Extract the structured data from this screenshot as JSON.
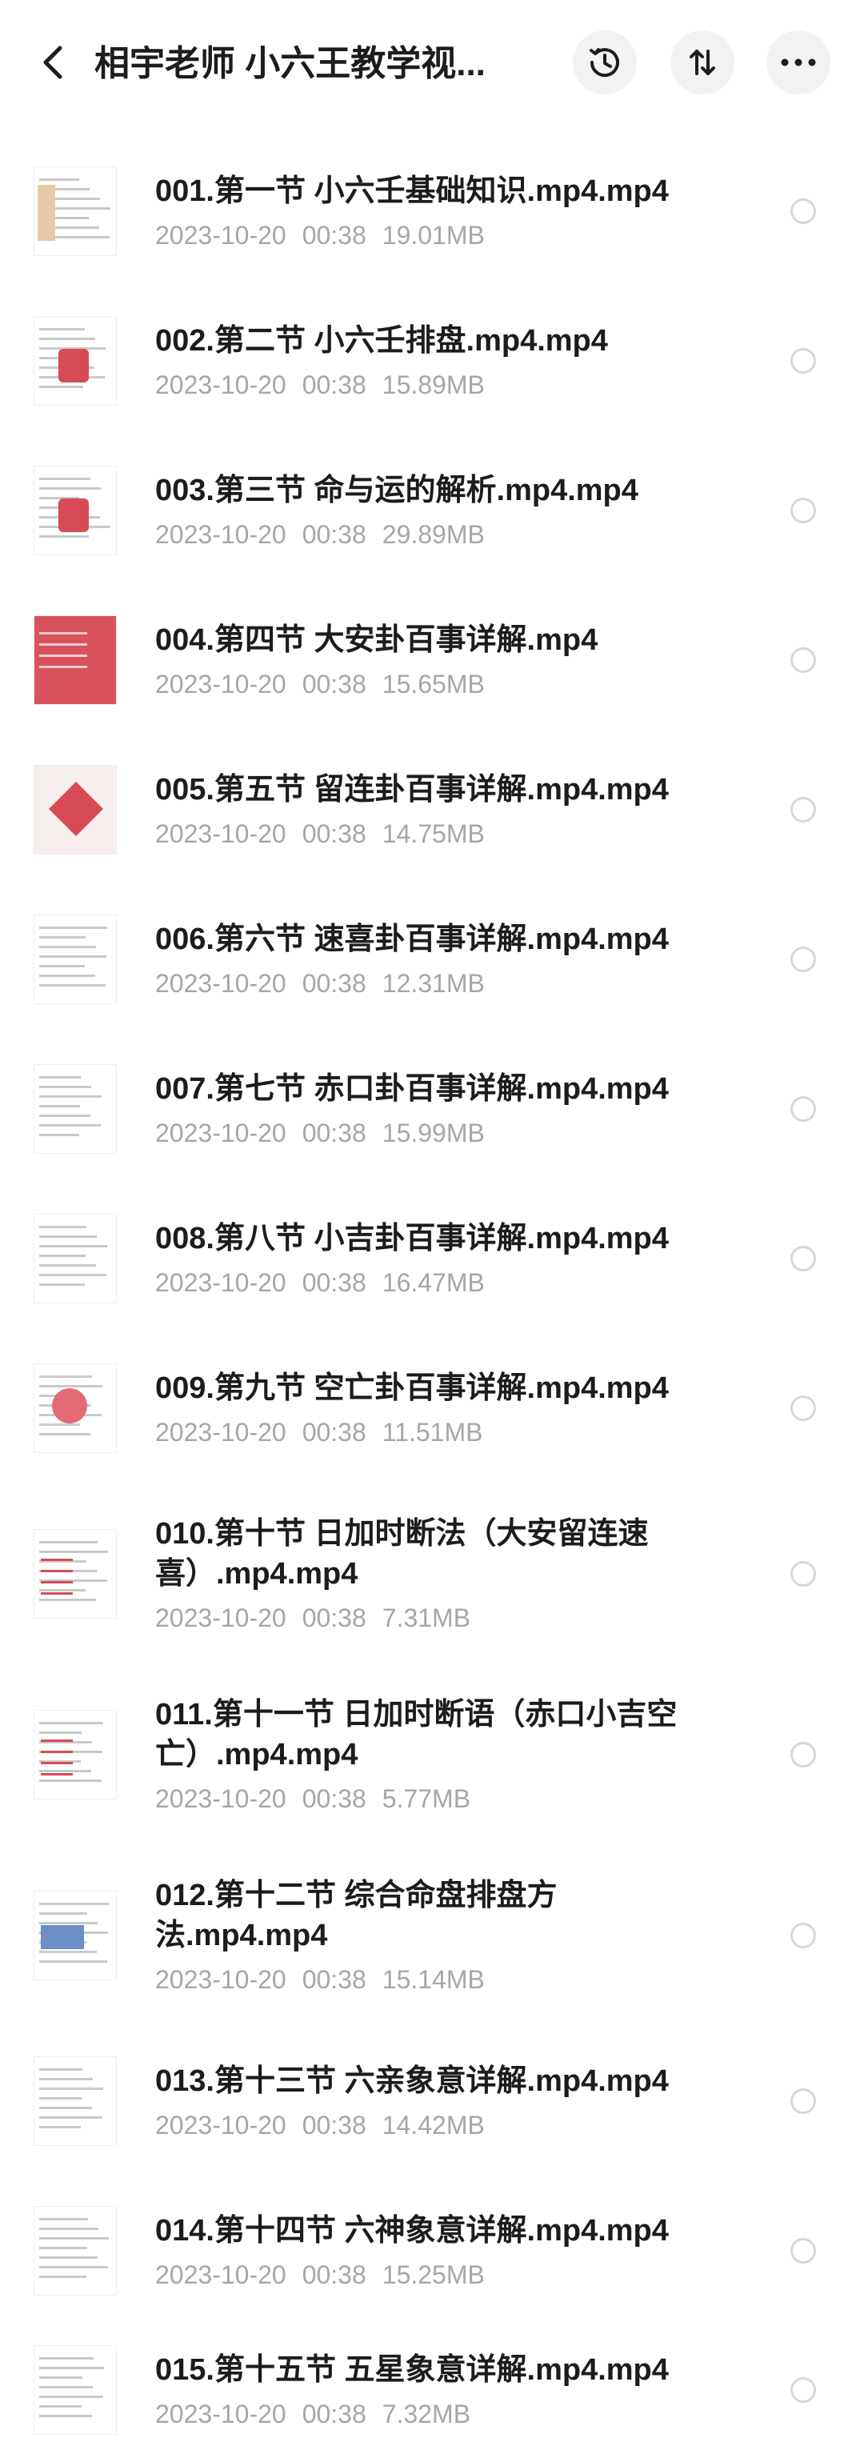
{
  "header": {
    "title": "相宇老师 小六王教学视...",
    "back_icon": "back-arrow-icon",
    "history_icon": "history-clock-icon",
    "sort_icon": "sort-arrows-icon",
    "more_icon": "more-dots-icon"
  },
  "colors": {
    "meta_text": "#a6a6a6",
    "button_bg": "#f1f2f4",
    "thumb_accent": "#d64b55"
  },
  "files": [
    {
      "name": "001.第一节 小六壬基础知识.mp4.mp4",
      "date": "2023-10-20",
      "time": "00:38",
      "size": "19.01MB"
    },
    {
      "name": "002.第二节 小六壬排盘.mp4.mp4",
      "date": "2023-10-20",
      "time": "00:38",
      "size": "15.89MB"
    },
    {
      "name": "003.第三节 命与运的解析.mp4.mp4",
      "date": "2023-10-20",
      "time": "00:38",
      "size": "29.89MB"
    },
    {
      "name": "004.第四节 大安卦百事详解.mp4",
      "date": "2023-10-20",
      "time": "00:38",
      "size": "15.65MB"
    },
    {
      "name": "005.第五节 留连卦百事详解.mp4.mp4",
      "date": "2023-10-20",
      "time": "00:38",
      "size": "14.75MB"
    },
    {
      "name": "006.第六节 速喜卦百事详解.mp4.mp4",
      "date": "2023-10-20",
      "time": "00:38",
      "size": "12.31MB"
    },
    {
      "name": "007.第七节 赤口卦百事详解.mp4.mp4",
      "date": "2023-10-20",
      "time": "00:38",
      "size": "15.99MB"
    },
    {
      "name": "008.第八节 小吉卦百事详解.mp4.mp4",
      "date": "2023-10-20",
      "time": "00:38",
      "size": "16.47MB"
    },
    {
      "name": "009.第九节 空亡卦百事详解.mp4.mp4",
      "date": "2023-10-20",
      "time": "00:38",
      "size": "11.51MB"
    },
    {
      "name": "010.第十节 日加时断法（大安留连速喜）.mp4.mp4",
      "date": "2023-10-20",
      "time": "00:38",
      "size": "7.31MB"
    },
    {
      "name": "011.第十一节 日加时断语（赤口小吉空亡）.mp4.mp4",
      "date": "2023-10-20",
      "time": "00:38",
      "size": "5.77MB"
    },
    {
      "name": "012.第十二节 综合命盘排盘方法.mp4.mp4",
      "date": "2023-10-20",
      "time": "00:38",
      "size": "15.14MB"
    },
    {
      "name": "013.第十三节 六亲象意详解.mp4.mp4",
      "date": "2023-10-20",
      "time": "00:38",
      "size": "14.42MB"
    },
    {
      "name": "014.第十四节 六神象意详解.mp4.mp4",
      "date": "2023-10-20",
      "time": "00:38",
      "size": "15.25MB"
    },
    {
      "name": "015.第十五节 五星象意详解.mp4.mp4",
      "date": "2023-10-20",
      "time": "00:38",
      "size": "7.32MB"
    }
  ]
}
